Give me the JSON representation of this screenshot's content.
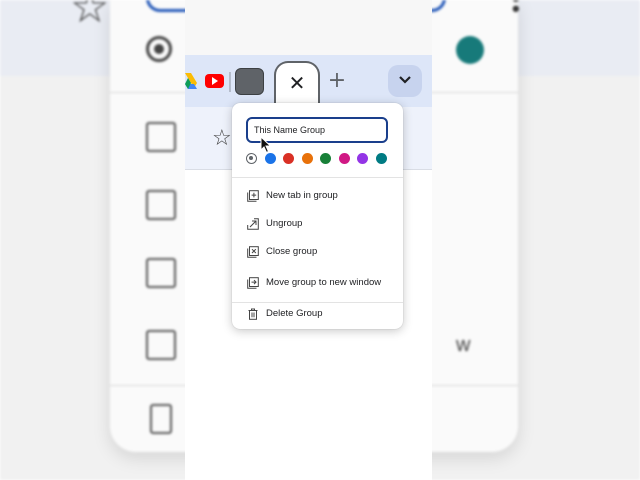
{
  "tab_strip": {
    "active_tab_close_glyph": "✕",
    "new_tab_glyph": "+",
    "group_chip_color": "#5f6368",
    "youtube_color": "#ff0000"
  },
  "group_editor": {
    "name_value": "This Name Group",
    "colors": [
      {
        "name": "grey",
        "hex": "#5f6368",
        "selected": true
      },
      {
        "name": "blue",
        "hex": "#1a73e8",
        "selected": false
      },
      {
        "name": "red",
        "hex": "#d93025",
        "selected": false
      },
      {
        "name": "orange",
        "hex": "#e8710a",
        "selected": false
      },
      {
        "name": "green",
        "hex": "#188038",
        "selected": false
      },
      {
        "name": "pink",
        "hex": "#d01884",
        "selected": false
      },
      {
        "name": "purple",
        "hex": "#9334e6",
        "selected": false
      },
      {
        "name": "cyan",
        "hex": "#007b83",
        "selected": false
      }
    ]
  },
  "menu": {
    "items": [
      {
        "label": "New tab in group",
        "icon": "new-tab-in-group-icon"
      },
      {
        "label": "Ungroup",
        "icon": "ungroup-icon"
      },
      {
        "label": "Close group",
        "icon": "close-group-icon"
      },
      {
        "label": "Move group to new window",
        "icon": "move-to-window-icon"
      },
      {
        "label": "Delete Group",
        "icon": "trash-icon"
      }
    ]
  }
}
